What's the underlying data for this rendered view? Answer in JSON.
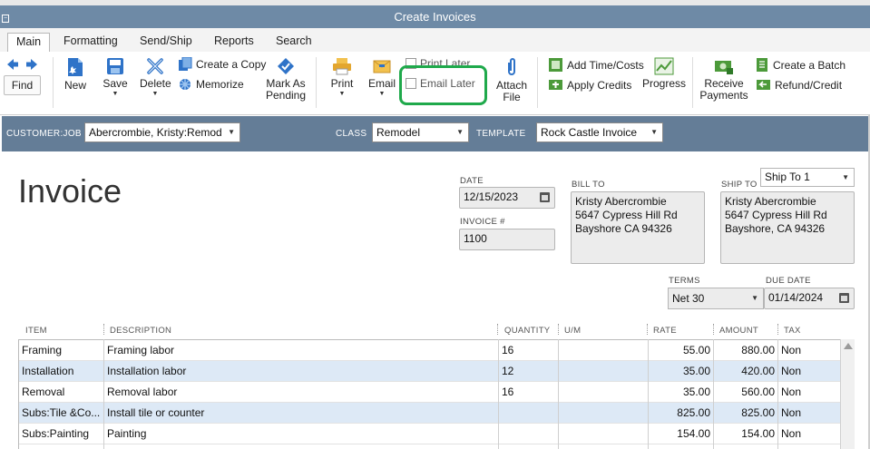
{
  "window": {
    "title": "Create Invoices"
  },
  "tabs": [
    "Main",
    "Formatting",
    "Send/Ship",
    "Reports",
    "Search"
  ],
  "toolbar": {
    "find": "Find",
    "new": "New",
    "save": "Save",
    "delete": "Delete",
    "create_copy": "Create a Copy",
    "memorize": "Memorize",
    "mark_as_pending": [
      "Mark As",
      "Pending"
    ],
    "print": "Print",
    "email": "Email",
    "print_later": "Print Later",
    "email_later": "Email Later",
    "attach_file": [
      "Attach",
      "File"
    ],
    "add_time_costs": "Add Time/Costs",
    "apply_credits": "Apply Credits",
    "progress": "Progress",
    "receive_payments": [
      "Receive",
      "Payments"
    ],
    "create_batch": "Create a Batch",
    "refund_credit": "Refund/Credit"
  },
  "header": {
    "customer_label": "CUSTOMER:JOB",
    "customer_value": "Abercrombie, Kristy:Remod",
    "class_label": "CLASS",
    "class_value": "Remodel",
    "template_label": "TEMPLATE",
    "template_value": "Rock Castle Invoice"
  },
  "form": {
    "title": "Invoice",
    "date_label": "DATE",
    "date_value": "12/15/2023",
    "invoice_no_label": "INVOICE #",
    "invoice_no_value": "1100",
    "bill_to_label": "BILL TO",
    "bill_to": [
      "Kristy Abercrombie",
      "5647 Cypress Hill Rd",
      "Bayshore CA 94326"
    ],
    "ship_to_label": "SHIP TO",
    "ship_to_select": "Ship To 1",
    "ship_to": [
      "Kristy Abercrombie",
      "5647 Cypress Hill Rd",
      "Bayshore, CA 94326"
    ],
    "terms_label": "TERMS",
    "terms_value": "Net 30",
    "due_date_label": "DUE DATE",
    "due_date_value": "01/14/2024"
  },
  "table": {
    "columns": [
      "ITEM",
      "DESCRIPTION",
      "QUANTITY",
      "U/M",
      "RATE",
      "AMOUNT",
      "TAX"
    ],
    "rows": [
      {
        "item": "Framing",
        "description": "Framing labor",
        "quantity": "16",
        "um": "",
        "rate": "55.00",
        "amount": "880.00",
        "tax": "Non"
      },
      {
        "item": "Installation",
        "description": "Installation labor",
        "quantity": "12",
        "um": "",
        "rate": "35.00",
        "amount": "420.00",
        "tax": "Non"
      },
      {
        "item": "Removal",
        "description": "Removal labor",
        "quantity": "16",
        "um": "",
        "rate": "35.00",
        "amount": "560.00",
        "tax": "Non"
      },
      {
        "item": "Subs:Tile &Co...",
        "description": "Install tile or counter",
        "quantity": "",
        "um": "",
        "rate": "825.00",
        "amount": "825.00",
        "tax": "Non"
      },
      {
        "item": "Subs:Painting",
        "description": "Painting",
        "quantity": "",
        "um": "",
        "rate": "154.00",
        "amount": "154.00",
        "tax": "Non"
      }
    ]
  },
  "colors": {
    "title_bar": "#6e8aa6",
    "header_band": "#647d97",
    "highlight": "#1fa94b",
    "row_alt": "#dde9f6"
  }
}
